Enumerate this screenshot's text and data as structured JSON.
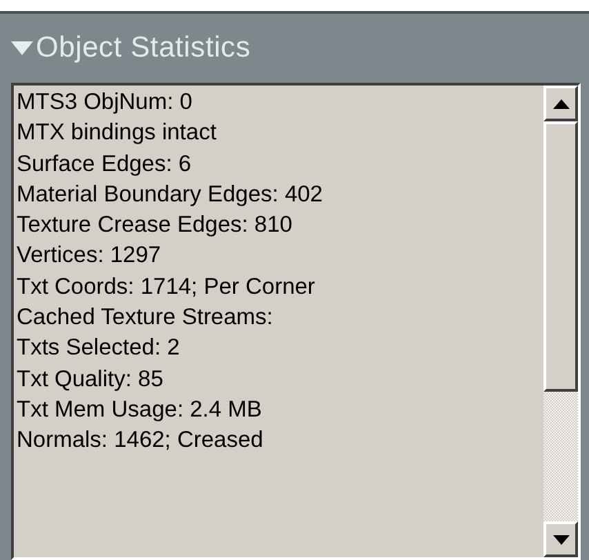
{
  "panel": {
    "title": "Object Statistics",
    "expanded": true,
    "lines": [
      "MTS3 ObjNum: 0",
      "MTX bindings intact",
      "Surface Edges: 6",
      "Material Boundary Edges: 402",
      "Texture Crease Edges: 810",
      "Vertices: 1297",
      "Txt Coords: 1714; Per Corner",
      "Cached Texture Streams:",
      "Txts Selected: 2",
      "Txt Quality: 85",
      "Txt Mem Usage: 2.4 MB",
      "Normals: 1462; Creased"
    ]
  }
}
